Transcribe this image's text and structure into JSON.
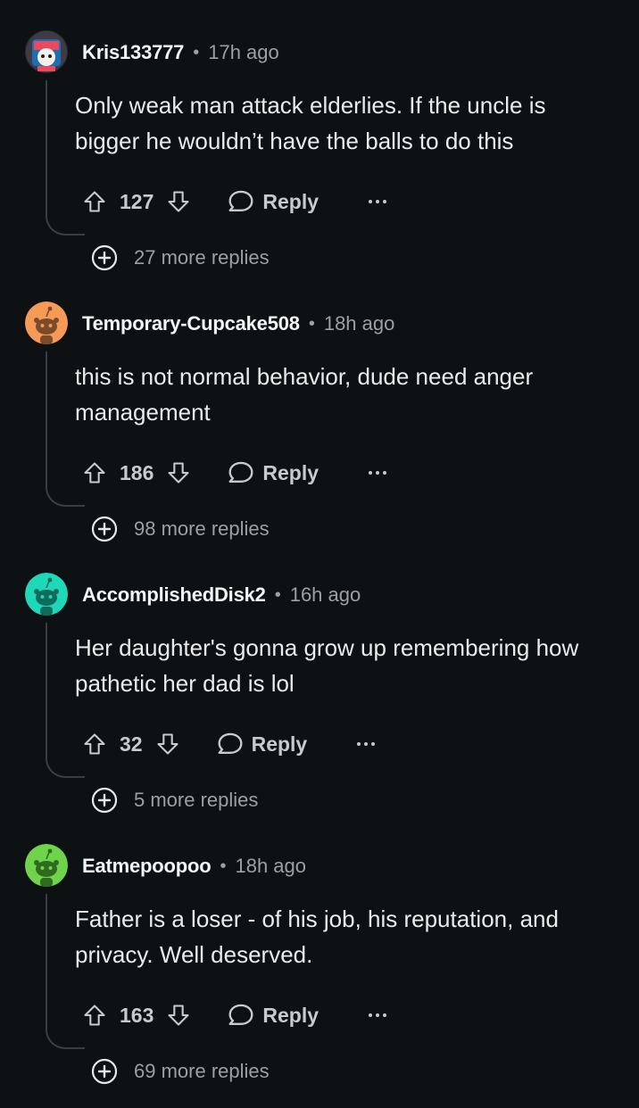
{
  "comments": [
    {
      "username": "Kris133777",
      "time": "17h ago",
      "body": "Only weak man attack elderlies. If the uncle is bigger he wouldn’t have the balls to do this",
      "score": "127",
      "reply_label": "Reply",
      "more_replies": "27 more replies",
      "avatar_icon": "custom-avatar-icon"
    },
    {
      "username": "Temporary-Cupcake508",
      "time": "18h ago",
      "body": "this is not normal behavior, dude need anger management",
      "score": "186",
      "reply_label": "Reply",
      "more_replies": "98 more replies",
      "avatar_color": "#f59b57",
      "avatar_icon": "snoo-avatar-icon"
    },
    {
      "username": "AccomplishedDisk2",
      "time": "16h ago",
      "body": "Her daughter's gonna grow up remembering how pathetic her dad is lol",
      "score": "32",
      "reply_label": "Reply",
      "more_replies": "5 more replies",
      "avatar_color": "#1fd8b8",
      "avatar_icon": "snoo-avatar-icon"
    },
    {
      "username": "Eatmepoopoo",
      "time": "18h ago",
      "body": "Father is a loser - of his job, his reputation, and privacy. Well deserved.",
      "score": "163",
      "reply_label": "Reply",
      "more_replies": "69 more replies",
      "avatar_color": "#6fd44b",
      "avatar_icon": "snoo-avatar-icon"
    }
  ],
  "separator": "•",
  "icons": {
    "upvote": "upvote-icon",
    "downvote": "downvote-icon",
    "reply": "reply-bubble-icon",
    "more": "more-options-icon",
    "expand": "plus-circle-icon"
  },
  "colors": {
    "background": "#0e1113",
    "username": "#f2f4f5",
    "meta": "#9aa0a6",
    "thread_line": "#3a3e42"
  }
}
